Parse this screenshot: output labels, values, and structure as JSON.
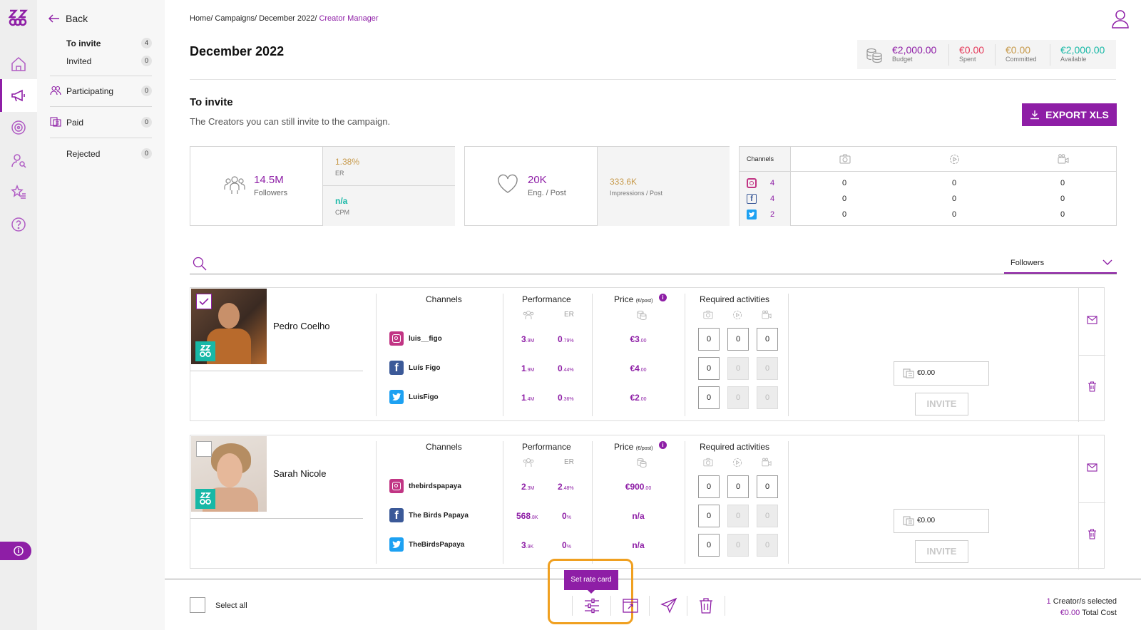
{
  "nav": {
    "back": "Back",
    "items": [
      {
        "label": "To invite",
        "count": "4"
      },
      {
        "label": "Invited",
        "count": "0"
      },
      {
        "label": "Participating",
        "count": "0"
      },
      {
        "label": "Paid",
        "count": "0"
      },
      {
        "label": "Rejected",
        "count": "0"
      }
    ]
  },
  "breadcrumb": {
    "items": [
      "Home/",
      "Campaigns/",
      "December 2022/"
    ],
    "current": "Creator Manager"
  },
  "page_title": "December 2022",
  "budget": {
    "budget": {
      "value": "€2,000.00",
      "label": "Budget",
      "color": "#8e1ea6"
    },
    "spent": {
      "value": "€0.00",
      "label": "Spent",
      "color": "#e53b5b"
    },
    "committed": {
      "value": "€0.00",
      "label": "Committed",
      "color": "#c79a4b"
    },
    "available": {
      "value": "€2,000.00",
      "label": "Available",
      "color": "#17b8a6"
    }
  },
  "section": {
    "title": "To invite",
    "subtitle": "The Creators you can still invite to the campaign.",
    "export": "EXPORT XLS"
  },
  "stats": {
    "followers": {
      "value": "14.5M",
      "label": "Followers"
    },
    "er": {
      "value": "1.38%",
      "label": "ER"
    },
    "cpm": {
      "value": "n/a",
      "label": "CPM"
    },
    "eng": {
      "value": "20K",
      "label": "Eng. / Post"
    },
    "impressions": {
      "value": "333.6K",
      "label": "Impressions / Post"
    },
    "channels": {
      "header": "Channels",
      "rows": [
        {
          "icon": "instagram-icon",
          "count": "4",
          "photo": "0",
          "story": "0",
          "video": "0"
        },
        {
          "icon": "facebook-icon",
          "count": "4",
          "photo": "0",
          "story": "0",
          "video": "0"
        },
        {
          "icon": "twitter-icon",
          "count": "2",
          "photo": "0",
          "story": "0",
          "video": "0"
        }
      ]
    }
  },
  "search": {
    "sort_label": "Followers"
  },
  "table_headers": {
    "channels": "Channels",
    "performance": "Performance",
    "price": "Price",
    "price_unit": "(€/post)",
    "er": "ER",
    "required": "Required activities"
  },
  "creators": [
    {
      "name": "Pedro Coelho",
      "checked": true,
      "channels": [
        {
          "icon": "instagram-icon",
          "handle": "luis__figo",
          "followers": "3",
          "followers_unit": ".9M",
          "er": "0",
          "er_unit": ".79%",
          "price": "€3",
          "price_cents": ".00",
          "acts": [
            "0",
            "0",
            "0"
          ]
        },
        {
          "icon": "facebook-icon",
          "handle": "Luís Figo",
          "followers": "1",
          "followers_unit": ".9M",
          "er": "0",
          "er_unit": ".44%",
          "price": "€4",
          "price_cents": ".00",
          "acts": [
            "0",
            "0",
            "0"
          ]
        },
        {
          "icon": "twitter-icon",
          "handle": "LuisFigo",
          "followers": "1",
          "followers_unit": ".4M",
          "er": "0",
          "er_unit": ".36%",
          "price": "€2",
          "price_cents": ".00",
          "acts": [
            "0",
            "0",
            "0"
          ]
        }
      ],
      "total": "€0.00",
      "invite": "INVITE"
    },
    {
      "name": "Sarah Nicole",
      "checked": false,
      "channels": [
        {
          "icon": "instagram-icon",
          "handle": "thebirdspapaya",
          "followers": "2",
          "followers_unit": ".3M",
          "er": "2",
          "er_unit": ".48%",
          "price": "€900",
          "price_cents": ".00",
          "acts": [
            "0",
            "0",
            "0"
          ]
        },
        {
          "icon": "facebook-icon",
          "handle": "The Birds Papaya",
          "followers": "568",
          "followers_unit": ".8K",
          "er": "0",
          "er_unit": "%",
          "price": "n/a",
          "price_cents": "",
          "acts": [
            "0",
            "0",
            "0"
          ]
        },
        {
          "icon": "twitter-icon",
          "handle": "TheBirdsPapaya",
          "followers": "3",
          "followers_unit": ".9K",
          "er": "0",
          "er_unit": "%",
          "price": "n/a",
          "price_cents": "",
          "acts": [
            "0",
            "0",
            "0"
          ]
        }
      ],
      "total": "€0.00",
      "invite": "INVITE"
    }
  ],
  "footer": {
    "select_all": "Select all",
    "tooltip": "Set rate card",
    "selected_count": "1",
    "selected_label": "Creator/s selected",
    "total_value": "€0.00",
    "total_label": "Total Cost"
  },
  "colors": {
    "accent": "#8e1ea6",
    "teal": "#17b8a6",
    "highlight": "#f0a020"
  }
}
